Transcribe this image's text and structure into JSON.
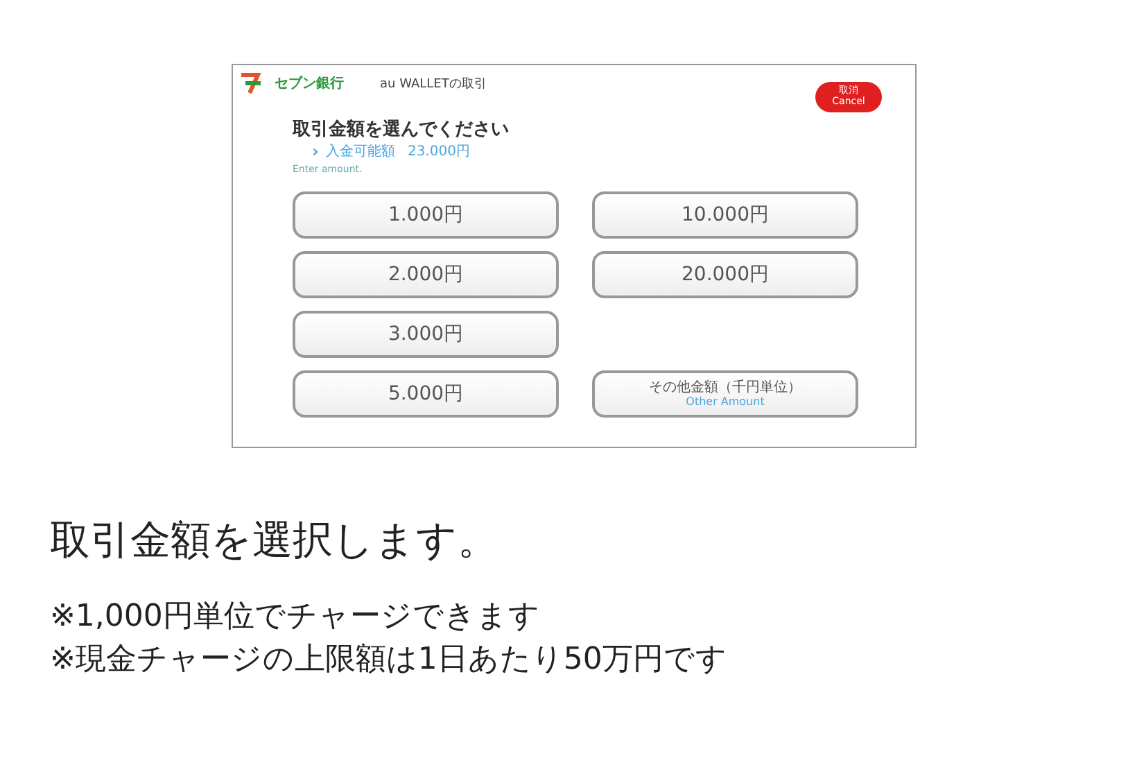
{
  "screen": {
    "bank_name": "セブン銀行",
    "transaction_title": "au WALLETの取引",
    "cancel_button": {
      "label": "取消",
      "sublabel": "Cancel"
    },
    "heading": "取引金額を選んでください",
    "available": {
      "arrow": "›",
      "label": "入金可能額",
      "amount": "23.000円"
    },
    "hint": "Enter amount.",
    "left_column": [
      {
        "kind": "amount",
        "label": "1.000円"
      },
      {
        "kind": "amount",
        "label": "2.000円"
      },
      {
        "kind": "amount",
        "label": "3.000円"
      },
      {
        "kind": "amount",
        "label": "5.000円"
      }
    ],
    "right_column": [
      {
        "kind": "amount",
        "label": "10.000円"
      },
      {
        "kind": "amount",
        "label": "20.000円"
      },
      {
        "kind": "other",
        "label": "その他金額（千円単位）",
        "sublabel": "Other Amount"
      }
    ]
  },
  "caption": "取引金額を選択します。",
  "notes": [
    "※1,000円単位でチャージできます",
    "※現金チャージの上限額は1日あたり50万円です"
  ]
}
